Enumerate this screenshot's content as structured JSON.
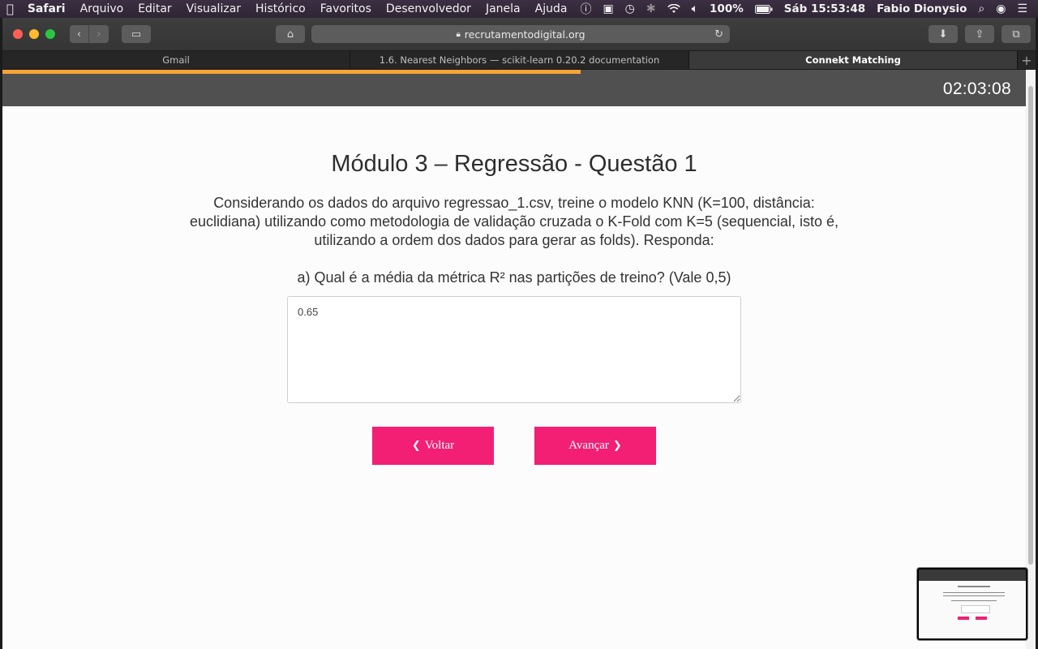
{
  "menubar": {
    "apple_icon": "apple-logo-icon",
    "app_name": "Safari",
    "items": [
      "Arquivo",
      "Editar",
      "Visualizar",
      "Histórico",
      "Favoritos",
      "Desenvolvedor",
      "Janela",
      "Ajuda"
    ],
    "battery": "100%",
    "datetime": "Sáb 15:53:48",
    "user": "Fabio Dionysio"
  },
  "browser": {
    "url": "recrutamentodigital.org",
    "tabs": [
      {
        "label": "Gmail"
      },
      {
        "label": "1.6. Nearest Neighbors — scikit-learn 0.20.2 documentation"
      },
      {
        "label": "Connekt Matching"
      }
    ]
  },
  "quiz": {
    "timer": "02:03:08",
    "progress_fraction": 0.565,
    "title": "Módulo 3 – Regressão - Questão 1",
    "description": "Considerando os dados do arquivo regressao_1.csv, treine o modelo KNN (K=100, distância: euclidiana) utilizando como metodologia de validação cruzada o K-Fold com K=5 (sequencial, isto é, utilizando a ordem dos dados para gerar as folds). Responda:",
    "question": "a) Qual é a média da métrica R² nas partições de treino? (Vale 0,5)",
    "answer": "0.65",
    "back_label": "Voltar",
    "next_label": "Avançar"
  },
  "colors": {
    "accent": "#f21f75",
    "progress": "#f6a338",
    "header_bar": "#505050"
  }
}
